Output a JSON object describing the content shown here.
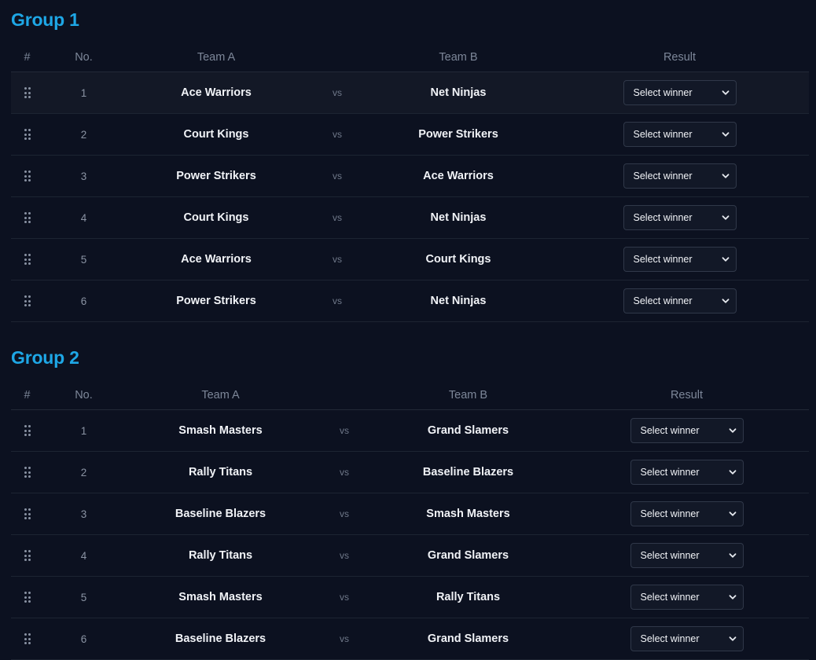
{
  "groups": [
    {
      "title": "Group 1",
      "headers": {
        "hash": "#",
        "no": "No.",
        "team_a": "Team A",
        "team_b": "Team B",
        "result": "Result"
      },
      "matches": [
        {
          "no": "1",
          "team_a": "Ace Warriors",
          "vs": "vs",
          "team_b": "Net Ninjas",
          "result": "Select winner"
        },
        {
          "no": "2",
          "team_a": "Court Kings",
          "vs": "vs",
          "team_b": "Power Strikers",
          "result": "Select winner"
        },
        {
          "no": "3",
          "team_a": "Power Strikers",
          "vs": "vs",
          "team_b": "Ace Warriors",
          "result": "Select winner"
        },
        {
          "no": "4",
          "team_a": "Court Kings",
          "vs": "vs",
          "team_b": "Net Ninjas",
          "result": "Select winner"
        },
        {
          "no": "5",
          "team_a": "Ace Warriors",
          "vs": "vs",
          "team_b": "Court Kings",
          "result": "Select winner"
        },
        {
          "no": "6",
          "team_a": "Power Strikers",
          "vs": "vs",
          "team_b": "Net Ninjas",
          "result": "Select winner"
        }
      ]
    },
    {
      "title": "Group 2",
      "headers": {
        "hash": "#",
        "no": "No.",
        "team_a": "Team A",
        "team_b": "Team B",
        "result": "Result"
      },
      "matches": [
        {
          "no": "1",
          "team_a": "Smash Masters",
          "vs": "vs",
          "team_b": "Grand Slamers",
          "result": "Select winner"
        },
        {
          "no": "2",
          "team_a": "Rally Titans",
          "vs": "vs",
          "team_b": "Baseline Blazers",
          "result": "Select winner"
        },
        {
          "no": "3",
          "team_a": "Baseline Blazers",
          "vs": "vs",
          "team_b": "Smash Masters",
          "result": "Select winner"
        },
        {
          "no": "4",
          "team_a": "Rally Titans",
          "vs": "vs",
          "team_b": "Grand Slamers",
          "result": "Select winner"
        },
        {
          "no": "5",
          "team_a": "Smash Masters",
          "vs": "vs",
          "team_b": "Rally Titans",
          "result": "Select winner"
        },
        {
          "no": "6",
          "team_a": "Baseline Blazers",
          "vs": "vs",
          "team_b": "Grand Slamers",
          "result": "Select winner"
        }
      ]
    }
  ],
  "icons": {
    "drag": "drag-handle-icon",
    "dropdown": "chevron-down-icon"
  },
  "colors": {
    "accent": "#1ea7e6",
    "background": "#0c1120"
  }
}
